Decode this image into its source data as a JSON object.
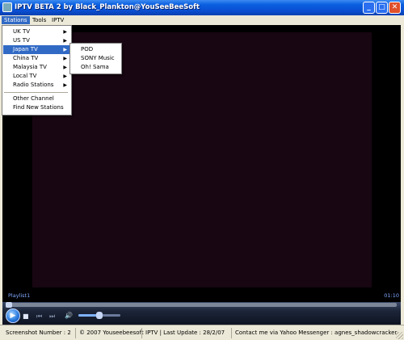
{
  "window": {
    "title": "IPTV BETA 2 by Black_Plankton@YouSeeBeeSoft"
  },
  "menubar": [
    "Stations",
    "Tools",
    "IPTV"
  ],
  "stations_menu": {
    "items": [
      "UK TV",
      "US TV",
      "Japan TV",
      "China TV",
      "Malaysia TV",
      "Local TV",
      "Radio Stations"
    ],
    "extra": [
      "Other Channel",
      "Find New Stations"
    ],
    "highlighted": "Japan TV"
  },
  "japan_submenu": [
    "POD",
    "SONY Music",
    "Oh! Sama"
  ],
  "player": {
    "playlist_label": "Playlist1",
    "time": "01:10",
    "volume_level": 0.5
  },
  "statusbar": [
    "Screenshot Number : 2",
    "© 2007 Youseebeesoft",
    "IPTV | Last Update : 28/2/07",
    "Contact me via Yahoo Messenger : agnes_shadowcracker"
  ],
  "colors": {
    "title_blue": "#0a5fe0",
    "highlight": "#316ac5",
    "video_bg": "#180612",
    "frame_bg": "#ece9d8"
  }
}
